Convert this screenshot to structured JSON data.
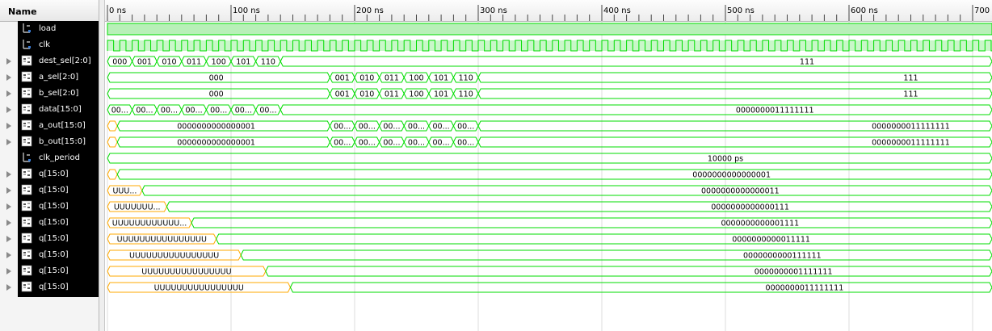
{
  "name_header": "Name",
  "time_unit_label": "ns",
  "ruler_labels": [
    "0 ns",
    "100 ns",
    "200 ns",
    "300 ns",
    "400 ns",
    "500 ns",
    "600 ns",
    "700 ns"
  ],
  "colors": {
    "wave": "#00dd00",
    "undefined": "#ffaa00",
    "clk_fill": "#c9f7c9",
    "highlight": "#b8f0b8",
    "name_bg": "#000000"
  },
  "signals": [
    {
      "name": "load",
      "type": "bit",
      "expandable": false
    },
    {
      "name": "clk",
      "type": "bit",
      "expandable": false
    },
    {
      "name": "dest_sel[2:0]",
      "type": "bus",
      "expandable": true,
      "values": [
        "000",
        "001",
        "010",
        "011",
        "100",
        "101",
        "110",
        "111"
      ]
    },
    {
      "name": "a_sel[2:0]",
      "type": "bus",
      "expandable": true,
      "values": [
        "000",
        "001",
        "010",
        "011",
        "100",
        "101",
        "110",
        "111"
      ]
    },
    {
      "name": "b_sel[2:0]",
      "type": "bus",
      "expandable": true,
      "values": [
        "000",
        "001",
        "010",
        "011",
        "100",
        "101",
        "110",
        "111"
      ]
    },
    {
      "name": "data[15:0]",
      "type": "bus",
      "expandable": true,
      "values": [
        "00...",
        "00...",
        "00...",
        "00...",
        "00...",
        "00...",
        "00...",
        "0000000011111111"
      ]
    },
    {
      "name": "a_out[15:0]",
      "type": "bus",
      "expandable": true,
      "values": [
        "0000000000000001",
        "00...",
        "00...",
        "00...",
        "00...",
        "00...",
        "00...",
        "0000000011111111"
      ]
    },
    {
      "name": "b_out[15:0]",
      "type": "bus",
      "expandable": true,
      "values": [
        "0000000000000001",
        "00...",
        "00...",
        "00...",
        "00...",
        "00...",
        "00...",
        "0000000011111111"
      ]
    },
    {
      "name": "clk_period",
      "type": "const",
      "expandable": false,
      "values": [
        "10000 ps"
      ]
    },
    {
      "name": "q[15:0]",
      "type": "bus",
      "expandable": true,
      "values": [
        "0000000000000001"
      ]
    },
    {
      "name": "q[15:0]",
      "type": "bus",
      "expandable": true,
      "values": [
        "UUU...",
        "0000000000000011"
      ]
    },
    {
      "name": "q[15:0]",
      "type": "bus",
      "expandable": true,
      "values": [
        "UUUUUUU...",
        "0000000000000111"
      ]
    },
    {
      "name": "q[15:0]",
      "type": "bus",
      "expandable": true,
      "values": [
        "UUUUUUUUUUUU...",
        "0000000000001111"
      ]
    },
    {
      "name": "q[15:0]",
      "type": "bus",
      "expandable": true,
      "values": [
        "UUUUUUUUUUUUUUUU",
        "0000000000011111"
      ]
    },
    {
      "name": "q[15:0]",
      "type": "bus",
      "expandable": true,
      "values": [
        "UUUUUUUUUUUUUUUU",
        "0000000000111111"
      ]
    },
    {
      "name": "q[15:0]",
      "type": "bus",
      "expandable": true,
      "values": [
        "UUUUUUUUUUUUUUUU",
        "0000000001111111"
      ]
    },
    {
      "name": "q[15:0]",
      "type": "bus",
      "expandable": true,
      "values": [
        "UUUUUUUUUUUUUUUU",
        "0000000011111111"
      ]
    }
  ]
}
